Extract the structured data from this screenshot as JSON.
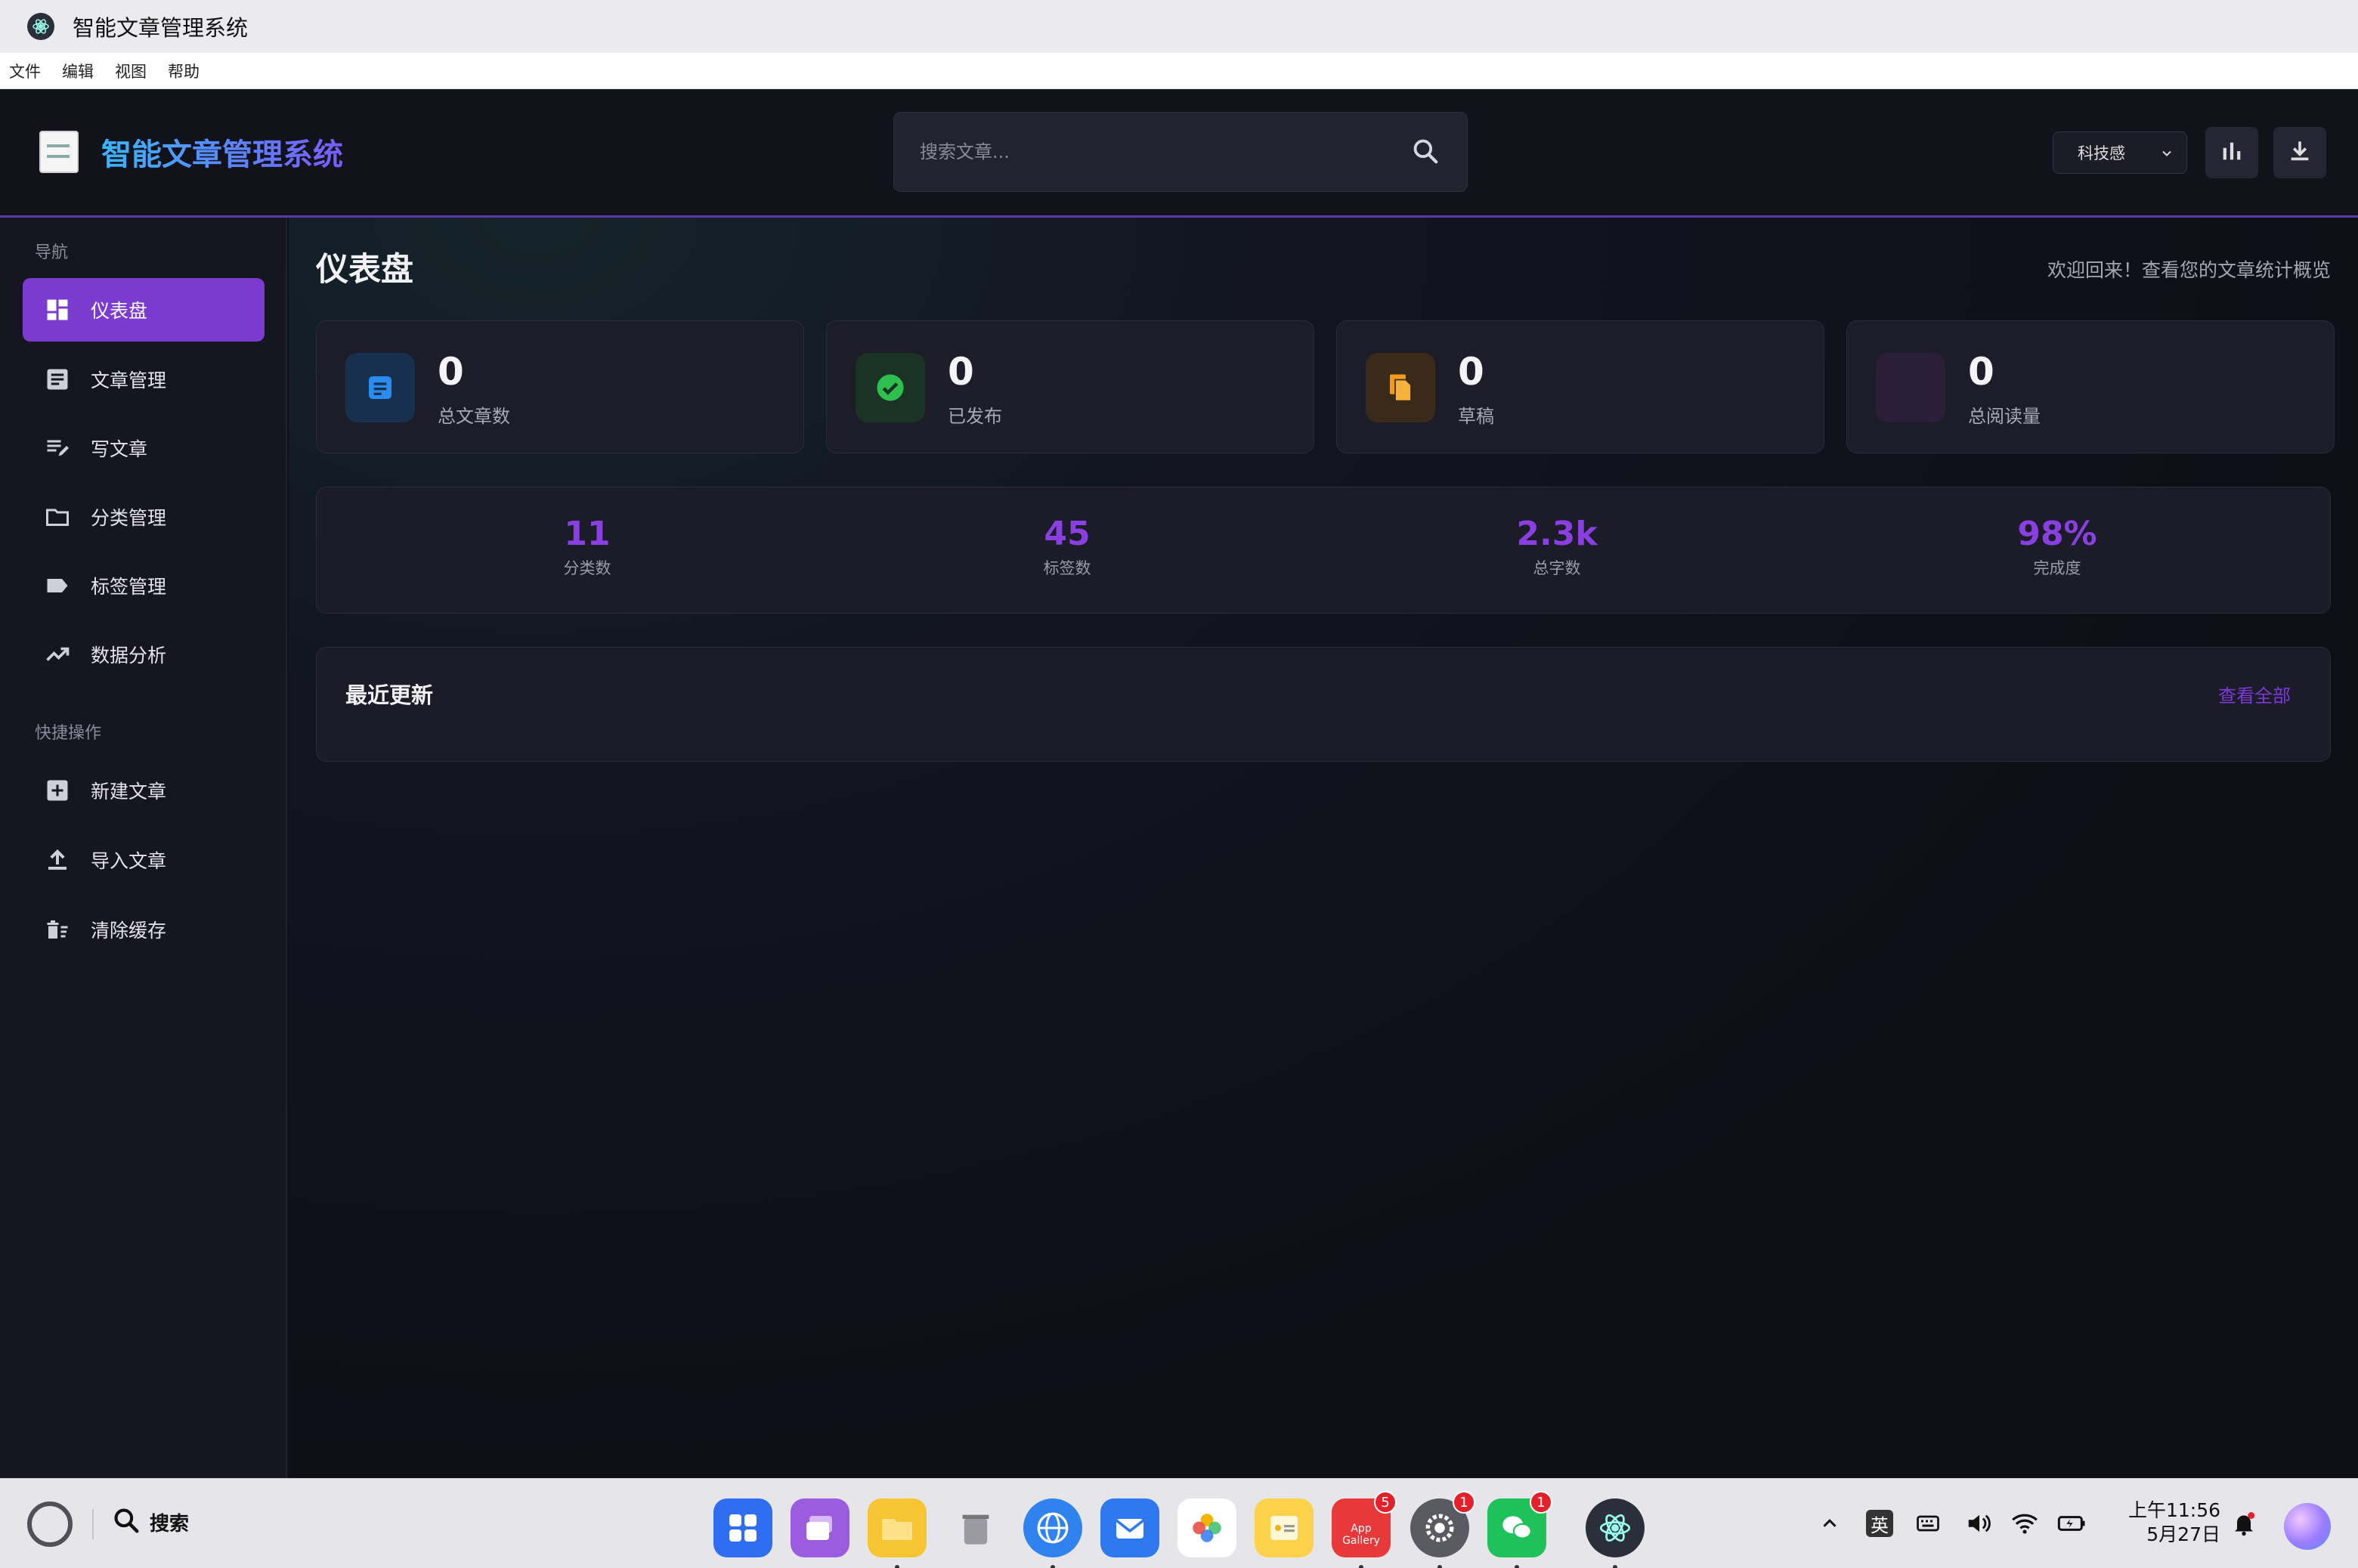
{
  "window": {
    "title": "智能文章管理系统"
  },
  "menubar": [
    "文件",
    "编辑",
    "视图",
    "帮助"
  ],
  "header": {
    "brand": "智能文章管理系统",
    "search_placeholder": "搜索文章...",
    "theme_selected": "科技感",
    "buttons": {
      "stats": "bar-chart-icon",
      "download": "download-icon"
    }
  },
  "sidebar": {
    "nav_title": "导航",
    "nav": [
      {
        "label": "仪表盘",
        "icon": "dashboard-icon",
        "active": true
      },
      {
        "label": "文章管理",
        "icon": "article-icon"
      },
      {
        "label": "写文章",
        "icon": "edit-note-icon"
      },
      {
        "label": "分类管理",
        "icon": "folder-icon"
      },
      {
        "label": "标签管理",
        "icon": "tag-icon"
      },
      {
        "label": "数据分析",
        "icon": "trending-up-icon"
      }
    ],
    "quick_title": "快捷操作",
    "quick": [
      {
        "label": "新建文章",
        "icon": "add-box-icon"
      },
      {
        "label": "导入文章",
        "icon": "upload-icon"
      },
      {
        "label": "清除缓存",
        "icon": "delete-sweep-icon"
      }
    ]
  },
  "main": {
    "title": "仪表盘",
    "welcome": "欢迎回来！查看您的文章统计概览",
    "stats": [
      {
        "value": "0",
        "label": "总文章数",
        "color": "#2b8cf0"
      },
      {
        "value": "0",
        "label": "已发布",
        "color": "#2fbf4e"
      },
      {
        "value": "0",
        "label": "草稿",
        "color": "#f29b16"
      },
      {
        "value": "0",
        "label": "总阅读量",
        "color": "#7a3ad6"
      }
    ],
    "summary": [
      {
        "value": "11",
        "label": "分类数"
      },
      {
        "value": "45",
        "label": "标签数"
      },
      {
        "value": "2.3k",
        "label": "总字数"
      },
      {
        "value": "98%",
        "label": "完成度"
      }
    ],
    "recent": {
      "title": "最近更新",
      "view_all": "查看全部"
    }
  },
  "taskbar": {
    "search_label": "搜索",
    "apps": [
      {
        "name": "launcher-icon",
        "badge": ""
      },
      {
        "name": "multitask-icon",
        "badge": ""
      },
      {
        "name": "files-icon",
        "badge": ""
      },
      {
        "name": "trash-icon",
        "badge": ""
      },
      {
        "name": "browser-icon",
        "badge": ""
      },
      {
        "name": "mail-icon",
        "badge": ""
      },
      {
        "name": "photos-icon",
        "badge": ""
      },
      {
        "name": "notes-icon",
        "badge": ""
      },
      {
        "name": "app-gallery-icon",
        "badge": "5",
        "text": "App Gallery"
      },
      {
        "name": "settings-icon",
        "badge": "1"
      },
      {
        "name": "wechat-icon",
        "badge": "1"
      },
      {
        "name": "electron-app-icon",
        "badge": ""
      }
    ],
    "ime": "英",
    "time": "上午11:56",
    "date": "5月27日"
  }
}
